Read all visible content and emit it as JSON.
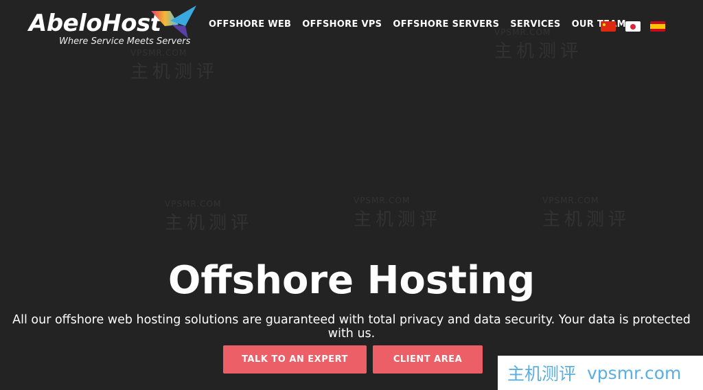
{
  "logo": {
    "name": "AbeloHost",
    "tagline": "Where Service Meets Servers"
  },
  "nav": [
    {
      "label": "OFFSHORE WEB"
    },
    {
      "label": "OFFSHORE VPS"
    },
    {
      "label": "OFFSHORE SERVERS"
    },
    {
      "label": "SERVICES"
    },
    {
      "label": "OUR TEAM"
    }
  ],
  "flags": [
    {
      "lang": "chinese",
      "icon": "china-flag-icon"
    },
    {
      "lang": "japanese",
      "icon": "japan-flag-icon"
    },
    {
      "lang": "spanish",
      "icon": "spain-flag-icon"
    }
  ],
  "hero": {
    "title": "Offshore Hosting",
    "subtitle": "All our offshore web hosting solutions are guaranteed with total privacy and data security. Your data is protected with us.",
    "buttons": [
      {
        "label": "TALK TO AN EXPERT"
      },
      {
        "label": "CLIENT AREA"
      }
    ]
  },
  "watermark": {
    "domain": "VPSMR.COM",
    "text": "主机测评",
    "badge_cn": "主机测评",
    "badge_url": "vpsmr.com"
  },
  "colors": {
    "background": "#232324",
    "accent": "#ec5f67",
    "badge_text": "#5aaee0"
  }
}
